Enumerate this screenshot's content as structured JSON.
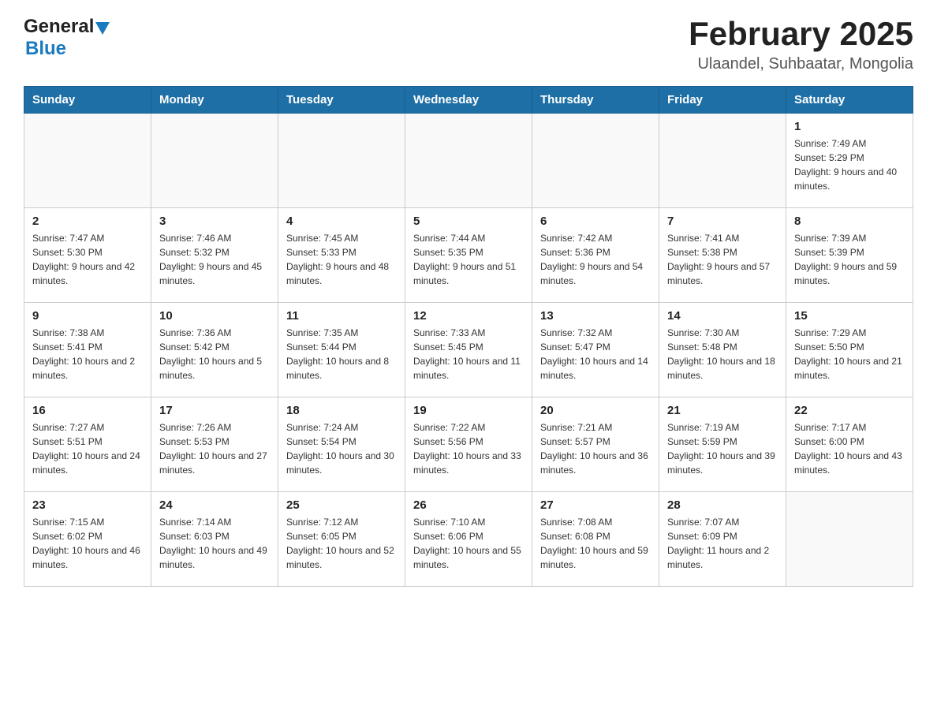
{
  "header": {
    "logo_general": "General",
    "logo_blue": "Blue",
    "title": "February 2025",
    "subtitle": "Ulaandel, Suhbaatar, Mongolia"
  },
  "weekdays": [
    "Sunday",
    "Monday",
    "Tuesday",
    "Wednesday",
    "Thursday",
    "Friday",
    "Saturday"
  ],
  "weeks": [
    [
      {
        "day": "",
        "info": ""
      },
      {
        "day": "",
        "info": ""
      },
      {
        "day": "",
        "info": ""
      },
      {
        "day": "",
        "info": ""
      },
      {
        "day": "",
        "info": ""
      },
      {
        "day": "",
        "info": ""
      },
      {
        "day": "1",
        "info": "Sunrise: 7:49 AM\nSunset: 5:29 PM\nDaylight: 9 hours and 40 minutes."
      }
    ],
    [
      {
        "day": "2",
        "info": "Sunrise: 7:47 AM\nSunset: 5:30 PM\nDaylight: 9 hours and 42 minutes."
      },
      {
        "day": "3",
        "info": "Sunrise: 7:46 AM\nSunset: 5:32 PM\nDaylight: 9 hours and 45 minutes."
      },
      {
        "day": "4",
        "info": "Sunrise: 7:45 AM\nSunset: 5:33 PM\nDaylight: 9 hours and 48 minutes."
      },
      {
        "day": "5",
        "info": "Sunrise: 7:44 AM\nSunset: 5:35 PM\nDaylight: 9 hours and 51 minutes."
      },
      {
        "day": "6",
        "info": "Sunrise: 7:42 AM\nSunset: 5:36 PM\nDaylight: 9 hours and 54 minutes."
      },
      {
        "day": "7",
        "info": "Sunrise: 7:41 AM\nSunset: 5:38 PM\nDaylight: 9 hours and 57 minutes."
      },
      {
        "day": "8",
        "info": "Sunrise: 7:39 AM\nSunset: 5:39 PM\nDaylight: 9 hours and 59 minutes."
      }
    ],
    [
      {
        "day": "9",
        "info": "Sunrise: 7:38 AM\nSunset: 5:41 PM\nDaylight: 10 hours and 2 minutes."
      },
      {
        "day": "10",
        "info": "Sunrise: 7:36 AM\nSunset: 5:42 PM\nDaylight: 10 hours and 5 minutes."
      },
      {
        "day": "11",
        "info": "Sunrise: 7:35 AM\nSunset: 5:44 PM\nDaylight: 10 hours and 8 minutes."
      },
      {
        "day": "12",
        "info": "Sunrise: 7:33 AM\nSunset: 5:45 PM\nDaylight: 10 hours and 11 minutes."
      },
      {
        "day": "13",
        "info": "Sunrise: 7:32 AM\nSunset: 5:47 PM\nDaylight: 10 hours and 14 minutes."
      },
      {
        "day": "14",
        "info": "Sunrise: 7:30 AM\nSunset: 5:48 PM\nDaylight: 10 hours and 18 minutes."
      },
      {
        "day": "15",
        "info": "Sunrise: 7:29 AM\nSunset: 5:50 PM\nDaylight: 10 hours and 21 minutes."
      }
    ],
    [
      {
        "day": "16",
        "info": "Sunrise: 7:27 AM\nSunset: 5:51 PM\nDaylight: 10 hours and 24 minutes."
      },
      {
        "day": "17",
        "info": "Sunrise: 7:26 AM\nSunset: 5:53 PM\nDaylight: 10 hours and 27 minutes."
      },
      {
        "day": "18",
        "info": "Sunrise: 7:24 AM\nSunset: 5:54 PM\nDaylight: 10 hours and 30 minutes."
      },
      {
        "day": "19",
        "info": "Sunrise: 7:22 AM\nSunset: 5:56 PM\nDaylight: 10 hours and 33 minutes."
      },
      {
        "day": "20",
        "info": "Sunrise: 7:21 AM\nSunset: 5:57 PM\nDaylight: 10 hours and 36 minutes."
      },
      {
        "day": "21",
        "info": "Sunrise: 7:19 AM\nSunset: 5:59 PM\nDaylight: 10 hours and 39 minutes."
      },
      {
        "day": "22",
        "info": "Sunrise: 7:17 AM\nSunset: 6:00 PM\nDaylight: 10 hours and 43 minutes."
      }
    ],
    [
      {
        "day": "23",
        "info": "Sunrise: 7:15 AM\nSunset: 6:02 PM\nDaylight: 10 hours and 46 minutes."
      },
      {
        "day": "24",
        "info": "Sunrise: 7:14 AM\nSunset: 6:03 PM\nDaylight: 10 hours and 49 minutes."
      },
      {
        "day": "25",
        "info": "Sunrise: 7:12 AM\nSunset: 6:05 PM\nDaylight: 10 hours and 52 minutes."
      },
      {
        "day": "26",
        "info": "Sunrise: 7:10 AM\nSunset: 6:06 PM\nDaylight: 10 hours and 55 minutes."
      },
      {
        "day": "27",
        "info": "Sunrise: 7:08 AM\nSunset: 6:08 PM\nDaylight: 10 hours and 59 minutes."
      },
      {
        "day": "28",
        "info": "Sunrise: 7:07 AM\nSunset: 6:09 PM\nDaylight: 11 hours and 2 minutes."
      },
      {
        "day": "",
        "info": ""
      }
    ]
  ]
}
